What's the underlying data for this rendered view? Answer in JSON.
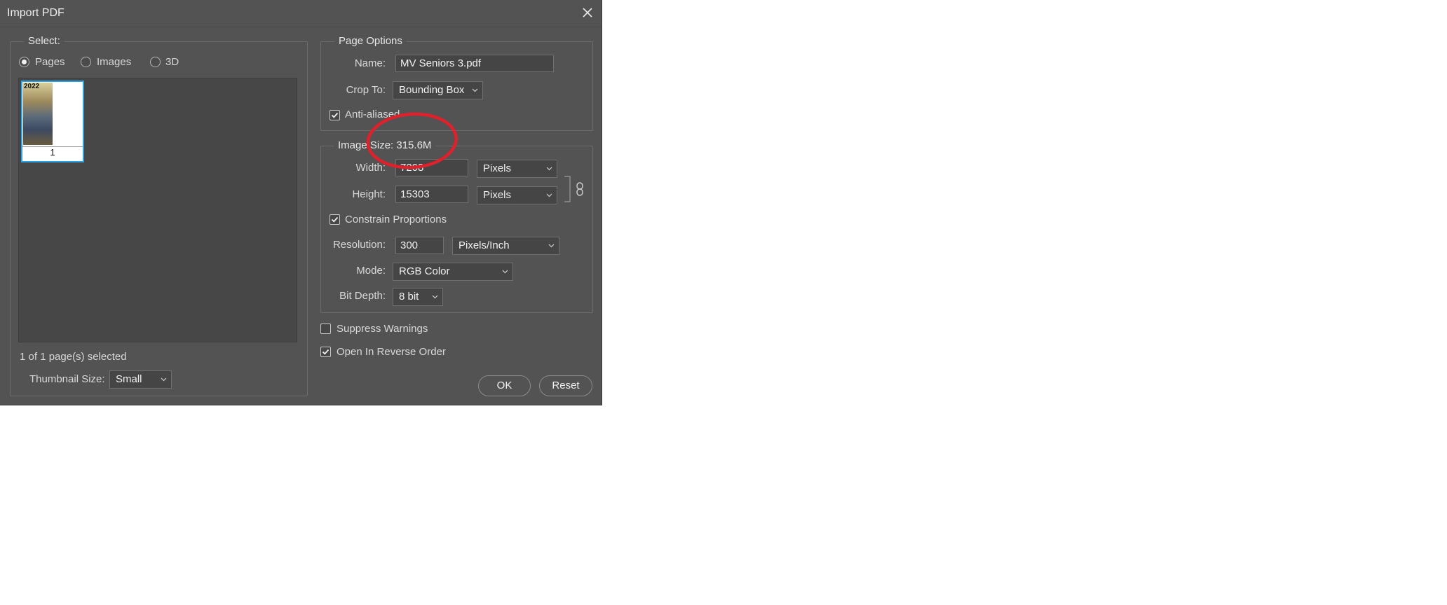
{
  "window": {
    "title": "Import PDF"
  },
  "select_group": {
    "legend": "Select:",
    "radios": [
      {
        "label": "Pages",
        "selected": true
      },
      {
        "label": "Images",
        "selected": false
      },
      {
        "label": "3D",
        "selected": false
      }
    ],
    "thumbnail": {
      "page_number": "1",
      "year_text": "2022"
    },
    "selection_status": "1 of 1 page(s) selected",
    "thumbnail_size": {
      "label": "Thumbnail Size:",
      "value": "Small"
    }
  },
  "page_options": {
    "legend": "Page Options",
    "name": {
      "label": "Name:",
      "value": "MV Seniors 3.pdf"
    },
    "crop_to": {
      "label": "Crop To:",
      "value": "Bounding Box"
    },
    "anti_aliased": {
      "label": "Anti-aliased",
      "checked": true
    }
  },
  "image_size": {
    "legend": "Image Size: 315.6M",
    "width": {
      "label": "Width:",
      "value": "7208",
      "unit": "Pixels"
    },
    "height": {
      "label": "Height:",
      "value": "15303",
      "unit": "Pixels"
    },
    "constrain": {
      "label": "Constrain Proportions",
      "checked": true
    },
    "resolution": {
      "label": "Resolution:",
      "value": "300",
      "unit": "Pixels/Inch"
    },
    "mode": {
      "label": "Mode:",
      "value": "RGB Color"
    },
    "bit_depth": {
      "label": "Bit Depth:",
      "value": "8 bit"
    }
  },
  "options": {
    "suppress_warnings": {
      "label": "Suppress Warnings",
      "checked": false
    },
    "reverse_order": {
      "label": "Open In Reverse Order",
      "checked": true
    }
  },
  "buttons": {
    "ok": "OK",
    "reset": "Reset"
  },
  "colors": {
    "dialog_bg": "#535353",
    "selection_blue": "#2aa3e6",
    "annotation_red": "#e0202a"
  }
}
